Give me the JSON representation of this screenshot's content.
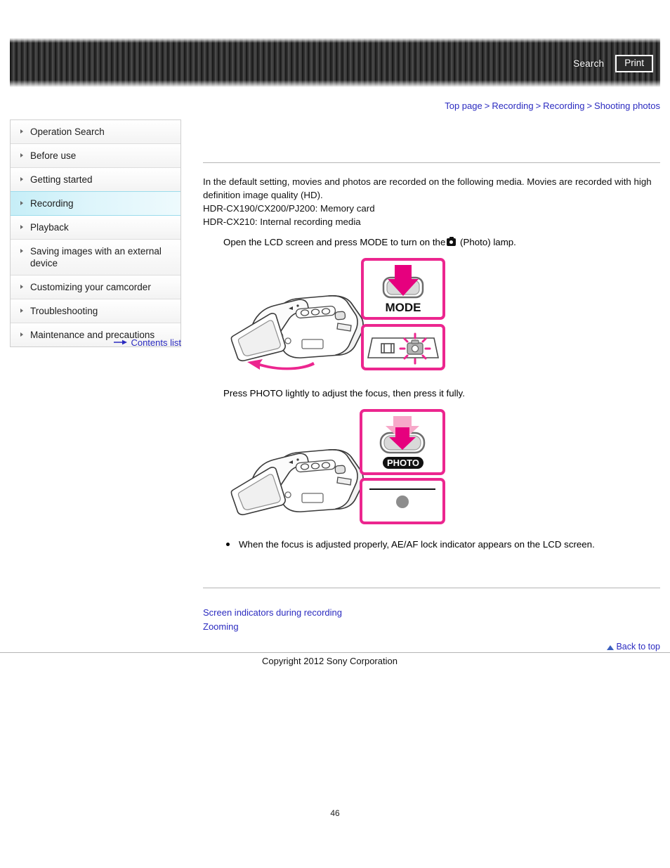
{
  "header": {
    "search_label": "Search",
    "print_label": "Print"
  },
  "breadcrumb": {
    "items": [
      "Top page",
      "Recording",
      "Recording",
      "Shooting photos"
    ],
    "separator": ">"
  },
  "sidebar": {
    "items": [
      {
        "label": "Operation Search",
        "active": false
      },
      {
        "label": "Before use",
        "active": false
      },
      {
        "label": "Getting started",
        "active": false
      },
      {
        "label": "Recording",
        "active": true
      },
      {
        "label": "Playback",
        "active": false
      },
      {
        "label": "Saving images with an external device",
        "active": false
      },
      {
        "label": "Customizing your camcorder",
        "active": false
      },
      {
        "label": "Troubleshooting",
        "active": false
      },
      {
        "label": "Maintenance and precautions",
        "active": false
      }
    ],
    "contents_list_label": "Contents list"
  },
  "main": {
    "intro_line1": "In the default setting, movies and photos are recorded on the following media. Movies are recorded with high definition image quality (HD).",
    "intro_line2": "HDR-CX190/CX200/PJ200: Memory card",
    "intro_line3": "HDR-CX210: Internal recording media",
    "step1_before_icon": "Open the LCD screen and press MODE to turn on the",
    "step1_after_icon": "(Photo) lamp.",
    "step2": "Press PHOTO lightly to adjust the focus, then press it fully.",
    "note": "When the focus is adjusted properly, AE/AF lock indicator appears on the LCD screen."
  },
  "illustrations": {
    "mode_button_label": "MODE",
    "photo_button_label": "PHOTO"
  },
  "related_links": [
    "Screen indicators during recording",
    "Zooming"
  ],
  "footer": {
    "back_to_top": "Back to top",
    "copyright": "Copyright 2012 Sony Corporation",
    "page_number": "46"
  },
  "colors": {
    "link": "#2b2bc0",
    "accent_pink": "#ec268f",
    "active_nav": "#c6eef7",
    "banner": "#3a3a3a"
  }
}
